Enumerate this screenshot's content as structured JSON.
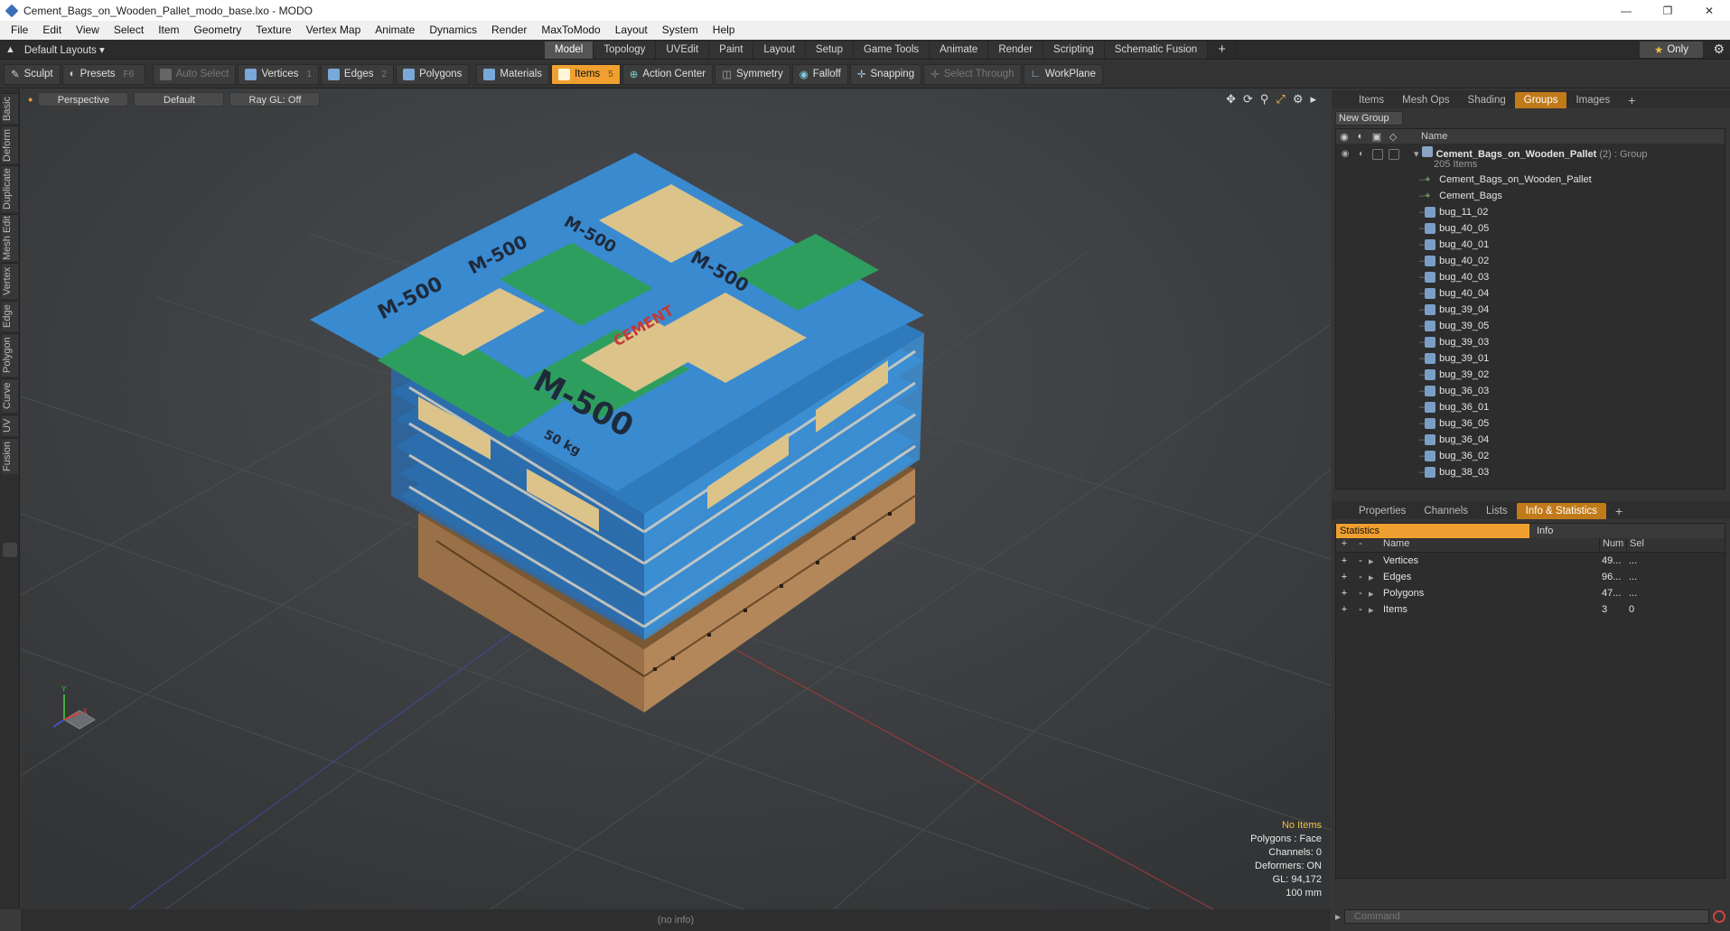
{
  "window": {
    "title": "Cement_Bags_on_Wooden_Pallet_modo_base.lxo - MODO"
  },
  "menu": [
    "File",
    "Edit",
    "View",
    "Select",
    "Item",
    "Geometry",
    "Texture",
    "Vertex Map",
    "Animate",
    "Dynamics",
    "Render",
    "MaxToModo",
    "Layout",
    "System",
    "Help"
  ],
  "layout": {
    "label": "Default Layouts",
    "tabs": [
      "Model",
      "Topology",
      "UVEdit",
      "Paint",
      "Layout",
      "Setup",
      "Game Tools",
      "Animate",
      "Render",
      "Scripting",
      "Schematic Fusion"
    ],
    "active_tab": "Model",
    "only_label": "Only"
  },
  "toolbar": {
    "sculpt": "Sculpt",
    "presets": "Presets",
    "presets_shortcut": "F6",
    "auto_select": "Auto Select",
    "vertices": "Vertices",
    "vertices_num": "1",
    "edges": "Edges",
    "edges_num": "2",
    "polygons": "Polygons",
    "materials": "Materials",
    "items": "Items",
    "items_num": "5",
    "action_center": "Action Center",
    "symmetry": "Symmetry",
    "falloff": "Falloff",
    "snapping": "Snapping",
    "select_through": "Select Through",
    "workplane": "WorkPlane"
  },
  "left_tabs": [
    "Basic",
    "Deform",
    "Duplicate",
    "Mesh Edit",
    "Vertex",
    "Edge",
    "Polygon",
    "Curve",
    "UV",
    "Fusion"
  ],
  "viewport": {
    "perspective": "Perspective",
    "shading": "Default",
    "raygl": "Ray GL: Off",
    "stats": {
      "no_items": "No Items",
      "polygons": "Polygons : Face",
      "channels": "Channels: 0",
      "deformers": "Deformers: ON",
      "gl": "GL: 94,172",
      "scale": "100 mm"
    },
    "axis_y": "Y",
    "axis_x": "X",
    "bag_label_big": "M-500",
    "bag_weight": "50 kg",
    "bag_brand": "CEMENT"
  },
  "groups_panel": {
    "tabs": [
      "Items",
      "Mesh Ops",
      "Shading",
      "Groups",
      "Images"
    ],
    "active_tab": "Groups",
    "new_group": "New Group",
    "col_name": "Name",
    "group_name": "Cement_Bags_on_Wooden_Pallet",
    "group_suffix": "(2) : Group",
    "group_count": "205 Items",
    "rows": [
      "Cement_Bags_on_Wooden_Pallet",
      "Cement_Bags",
      "bug_11_02",
      "bug_40_05",
      "bug_40_01",
      "bug_40_02",
      "bug_40_03",
      "bug_40_04",
      "bug_39_04",
      "bug_39_05",
      "bug_39_03",
      "bug_39_01",
      "bug_39_02",
      "bug_36_03",
      "bug_36_01",
      "bug_36_05",
      "bug_36_04",
      "bug_36_02",
      "bug_38_03"
    ]
  },
  "info_panel": {
    "tabs": [
      "Properties",
      "Channels",
      "Lists",
      "Info & Statistics"
    ],
    "active_tab": "Info & Statistics",
    "statistics": "Statistics",
    "info": "Info",
    "col_name": "Name",
    "col_num": "Num",
    "col_sel": "Sel",
    "rows": [
      {
        "name": "Vertices",
        "num": "49...",
        "sel": "..."
      },
      {
        "name": "Edges",
        "num": "96...",
        "sel": "..."
      },
      {
        "name": "Polygons",
        "num": "47...",
        "sel": "..."
      },
      {
        "name": "Items",
        "num": "3",
        "sel": "0"
      }
    ],
    "command_placeholder": "Command"
  },
  "statusbar": {
    "text": "(no info)"
  },
  "colors": {
    "accent": "#f0a030",
    "bag_blue": "#3a86c8",
    "bag_tan": "#dcc38a",
    "bag_green": "#2e9e5e",
    "pallet": "#a07a52",
    "viewport_bg": "#3f4244"
  }
}
